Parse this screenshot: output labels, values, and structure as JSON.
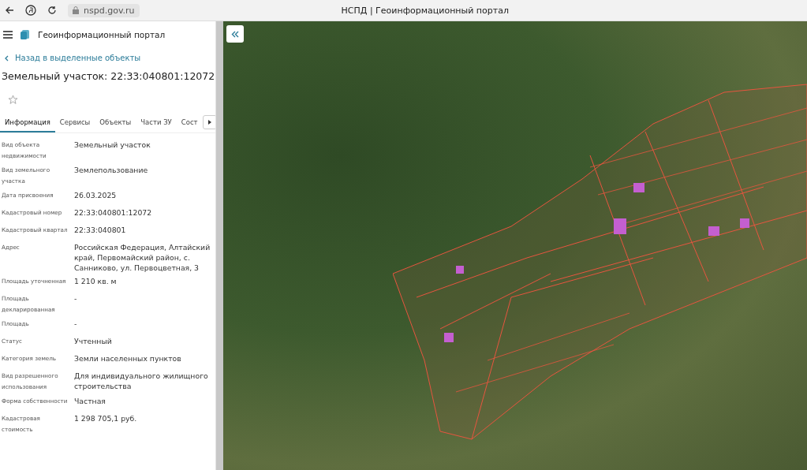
{
  "browser": {
    "url": "nspd.gov.ru",
    "title": "НСПД | Геоинформационный портал"
  },
  "header": {
    "title": "Геоинформационный портал"
  },
  "back_link": "Назад в выделенные объекты",
  "object_title": "Земельный участок: 22:33:040801:12072",
  "favorite": {
    "on": false
  },
  "tabs": [
    {
      "label": "Информация",
      "selected": true
    },
    {
      "label": "Сервисы",
      "selected": false
    },
    {
      "label": "Объекты",
      "selected": false
    },
    {
      "label": "Части ЗУ",
      "selected": false
    },
    {
      "label": "Сост",
      "selected": false
    }
  ],
  "fields": [
    {
      "label": "Вид объекта недвижимости",
      "value": "Земельный участок"
    },
    {
      "label": "Вид земельного участка",
      "value": "Землепользование"
    },
    {
      "label": "Дата присвоения",
      "value": "26.03.2025"
    },
    {
      "label": "Кадастровый номер",
      "value": "22:33:040801:12072"
    },
    {
      "label": "Кадастровый квартал",
      "value": "22:33:040801"
    },
    {
      "label": "Адрес",
      "value": "Российская Федерация, Алтайский край, Первомайский район, с. Санниково, ул. Первоцветная, 3"
    },
    {
      "label": "Площадь уточненная",
      "value": "1 210 кв. м"
    },
    {
      "label": "Площадь декларированная",
      "value": "-"
    },
    {
      "label": "Площадь",
      "value": "-"
    },
    {
      "label": "Статус",
      "value": "Учтенный"
    },
    {
      "label": "Категория земель",
      "value": "Земли населенных пунктов"
    },
    {
      "label": "Вид разрешенного использования",
      "value": "Для индивидуального жилищного строительства"
    },
    {
      "label": "Форма собственности",
      "value": "Частная"
    },
    {
      "label": "Кадастровая стоимость",
      "value": "1 298 705,1 руб."
    }
  ]
}
